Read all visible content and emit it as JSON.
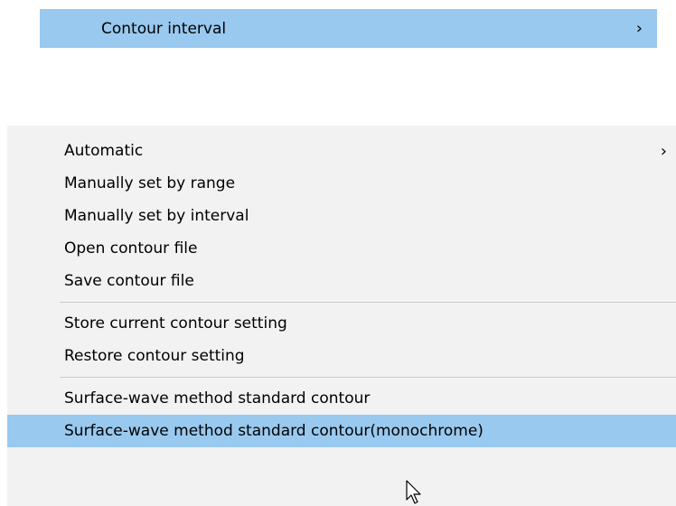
{
  "parent_menu": {
    "label": "Contour interval",
    "submenu_indicator": "›"
  },
  "submenu": {
    "items": [
      {
        "label": "Automatic",
        "submenu_indicator": "›"
      },
      {
        "label": "Manually set by range"
      },
      {
        "label": "Manually set by interval"
      },
      {
        "label": "Open contour file"
      },
      {
        "label": "Save contour file"
      },
      {
        "label": "Store current contour setting"
      },
      {
        "label": "Restore contour setting"
      },
      {
        "label": "Surface-wave method standard contour"
      },
      {
        "label": "Surface-wave method standard contour(monochrome)",
        "highlighted": true
      }
    ]
  },
  "colors": {
    "highlight": "#99c9ef",
    "menu_background": "#f2f2f2",
    "separator": "#cccccc"
  },
  "cursor": {
    "icon": "arrow-pointer-icon"
  }
}
